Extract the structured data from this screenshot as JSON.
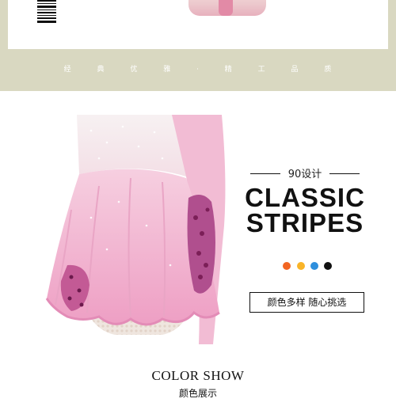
{
  "top": {
    "tagline": "经 典 优 雅 · 精 工 品 质"
  },
  "design": {
    "label": "90设计",
    "headline_line1": "CLASSIC",
    "headline_line2": "STRIPES",
    "color_dots": [
      "#f26522",
      "#f9b428",
      "#2e8fdd",
      "#111111"
    ],
    "color_button": "颜色多样 随心挑选"
  },
  "footer": {
    "title": "COLOR SHOW",
    "subtitle": "颜色展示"
  }
}
